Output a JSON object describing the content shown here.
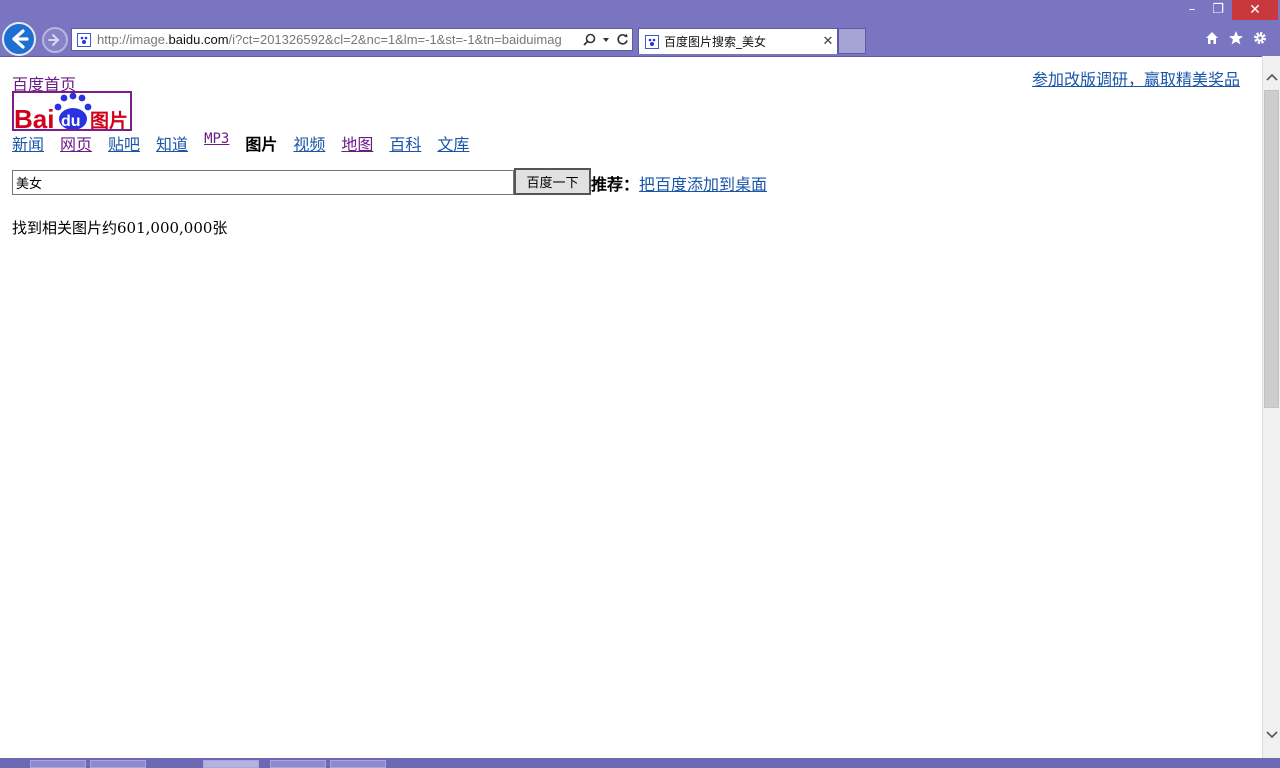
{
  "window": {
    "min_label": "–",
    "restore_label": "❐",
    "close_label": "✕"
  },
  "address_bar": {
    "url_prefix": "http://image.",
    "url_host": "baidu.com",
    "url_suffix": "/i?ct=201326592&cl=2&nc=1&lm=-1&st=-1&tn=baiduimag"
  },
  "tab": {
    "title": "百度图片搜索_美女",
    "close_label": "✕"
  },
  "page": {
    "home_link": "百度首页",
    "survey_link": "参加改版调研，赢取精美奖品",
    "logo_text": "Bai du 图片",
    "nav": [
      {
        "label": "新闻"
      },
      {
        "label": "网页"
      },
      {
        "label": "贴吧"
      },
      {
        "label": "知道"
      },
      {
        "label": "MP3"
      },
      {
        "label": "图片"
      },
      {
        "label": "视频"
      },
      {
        "label": "地图"
      },
      {
        "label": "百科"
      },
      {
        "label": "文库"
      }
    ],
    "search": {
      "value": "美女",
      "button_label": "百度一下"
    },
    "recommend_label": "推荐：",
    "recommend_link": "把百度添加到桌面",
    "result_count": "找到相关图片约601,000,000张"
  },
  "colors": {
    "chrome": "#7a75c0",
    "link": "#1a56a8",
    "visited": "#6b1c86",
    "logo_red": "#d0021b",
    "logo_blue": "#2932e1"
  }
}
